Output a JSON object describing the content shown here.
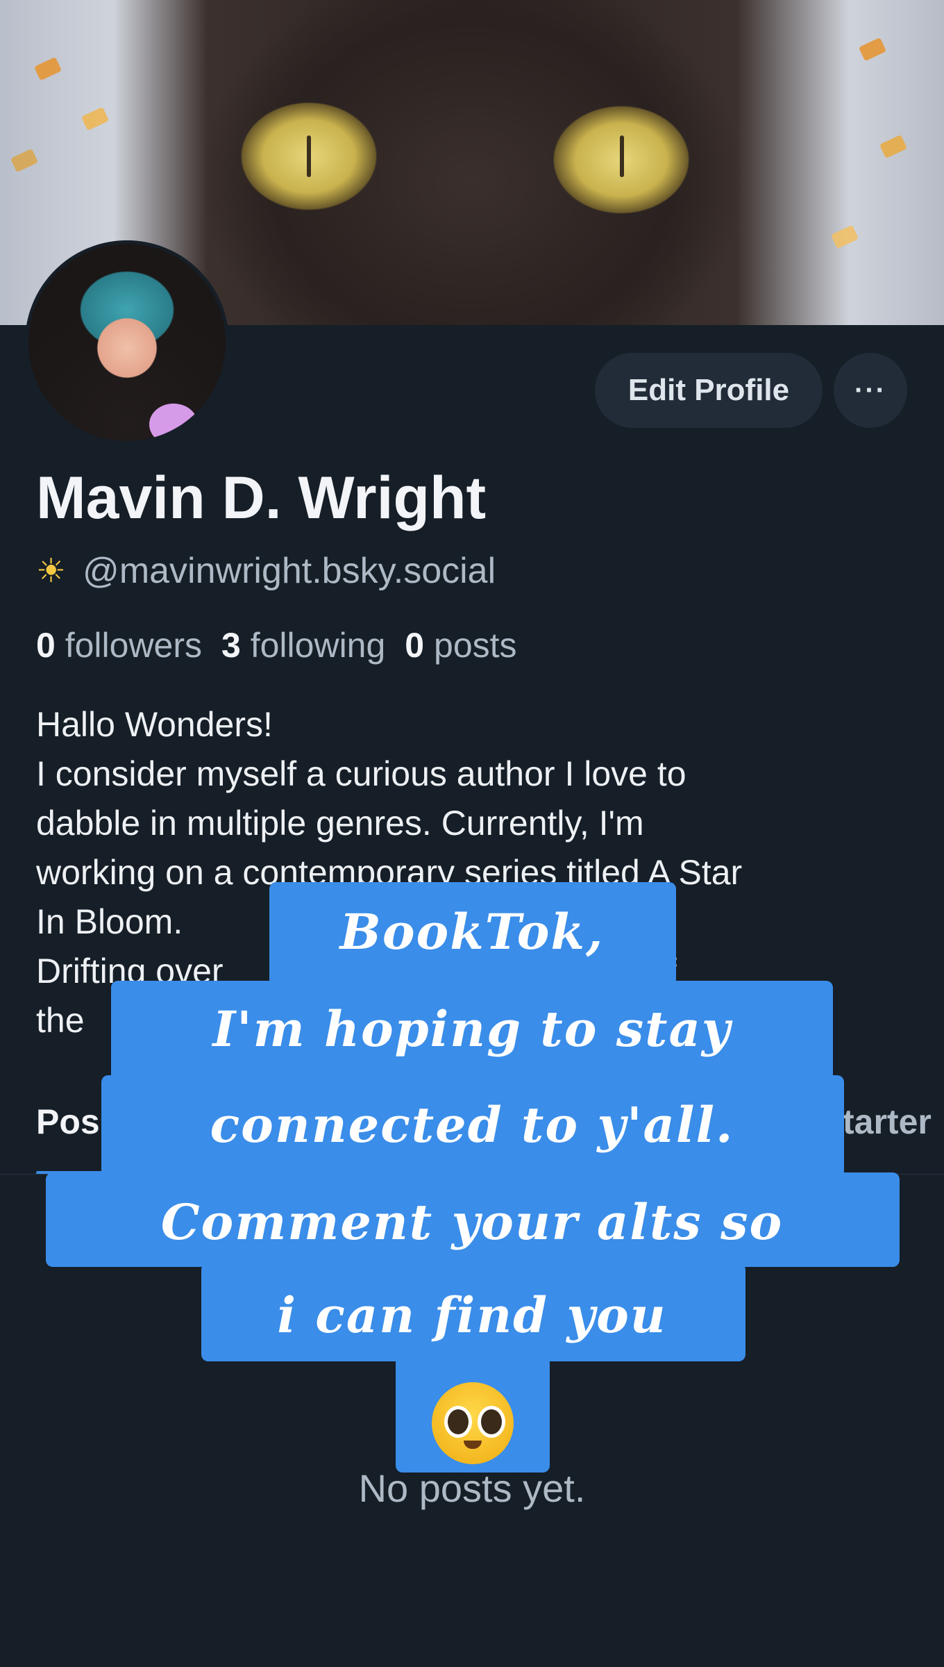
{
  "profile": {
    "name": "Mavin D. Wright",
    "handle": "@mavinwright.bsky.social",
    "edit_label": "Edit Profile",
    "more_label": "···",
    "stats": {
      "followers_count": "0",
      "followers_label": "followers",
      "following_count": "3",
      "following_label": "following",
      "posts_count": "0",
      "posts_label": "posts"
    },
    "bio_lines": [
      "Hallo Wonders!",
      "I consider myself a curious author I love to",
      "dabble in multiple genres. Currently, I'm",
      "working on a contemporary series titled A Star",
      "In Bloom.",
      "Drifting over                                  doom of",
      "the"
    ]
  },
  "tabs": {
    "posts": "Pos",
    "starter": "tarter"
  },
  "feed": {
    "empty_text": "No posts yet."
  },
  "overlay": {
    "lines": [
      "BookTok,",
      "I'm hoping to stay",
      "connected to y'all.",
      "Comment your alts so",
      "i can find you"
    ],
    "emoji_icon": "pleading-face-icon"
  },
  "colors": {
    "accent": "#3a8de9",
    "background": "#161e27"
  }
}
